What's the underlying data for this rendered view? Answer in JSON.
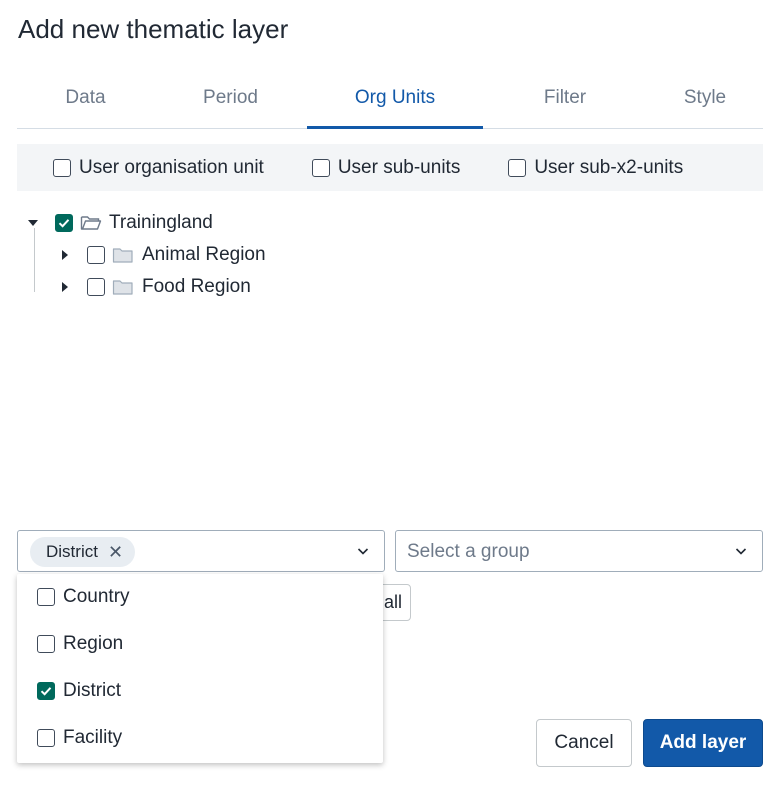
{
  "dialog": {
    "title": "Add new thematic layer"
  },
  "tabs": [
    {
      "label": "Data"
    },
    {
      "label": "Period"
    },
    {
      "label": "Org Units"
    },
    {
      "label": "Filter"
    },
    {
      "label": "Style"
    }
  ],
  "user_options": [
    {
      "label": "User organisation unit",
      "checked": false
    },
    {
      "label": "User sub-units",
      "checked": false
    },
    {
      "label": "User sub-x2-units",
      "checked": false
    }
  ],
  "tree": {
    "root": {
      "label": "Trainingland",
      "checked": true,
      "expanded": true
    },
    "children": [
      {
        "label": "Animal Region",
        "checked": false
      },
      {
        "label": "Food Region",
        "checked": false
      }
    ]
  },
  "level_select": {
    "selected_chip": "District"
  },
  "group_select": {
    "placeholder": "Select a group"
  },
  "behind_button": {
    "label": "Deselect all"
  },
  "level_options": [
    {
      "label": "Country",
      "checked": false
    },
    {
      "label": "Region",
      "checked": false
    },
    {
      "label": "District",
      "checked": true
    },
    {
      "label": "Facility",
      "checked": false
    }
  ],
  "footer": {
    "cancel_label": "Cancel",
    "add_label": "Add layer"
  },
  "colors": {
    "primary": "#1259a9",
    "checked": "#00695c"
  }
}
